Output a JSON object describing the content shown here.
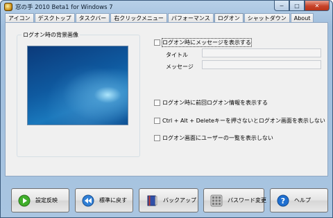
{
  "window": {
    "title": "窓の手 2010 Beta1 for Windows 7",
    "controls": {
      "minimize": "−",
      "maximize": "□",
      "close": "✕"
    }
  },
  "tabs": [
    {
      "label": "アイコン",
      "active": false
    },
    {
      "label": "デスクトップ",
      "active": false
    },
    {
      "label": "タスクバー",
      "active": false
    },
    {
      "label": "右クリックメニュー",
      "active": false
    },
    {
      "label": "パフォーマンス",
      "active": false
    },
    {
      "label": "ログオン",
      "active": true
    },
    {
      "label": "シャットダウン",
      "active": false
    },
    {
      "label": "About",
      "active": false
    }
  ],
  "logon": {
    "background_group_title": "ログオン時の背景画像",
    "show_message_label": "ログオン時にメッセージを表示する",
    "title_label": "タイトル",
    "title_value": "",
    "message_label": "メッセージ",
    "message_value": "",
    "show_previous_logon_label": "ログオン時に前回ログオン情報を表示する",
    "no_ctrl_alt_del_label": "Ctrl + Alt + Deleteキーを押さないとログオン画面を表示しない",
    "hide_user_list_label": "ログオン画面にユーザーの一覧を表示しない"
  },
  "buttons": {
    "apply": "設定反映",
    "restore": "標準に戻す",
    "backup": "バックアップ",
    "password": "パスワード変更",
    "help": "ヘルプ"
  },
  "colors": {
    "apply_icon": "#3fae2a",
    "restore_icon": "#2f7fd6",
    "help_icon": "#1f6fd0",
    "backup_icon": "#2f4fa8"
  }
}
